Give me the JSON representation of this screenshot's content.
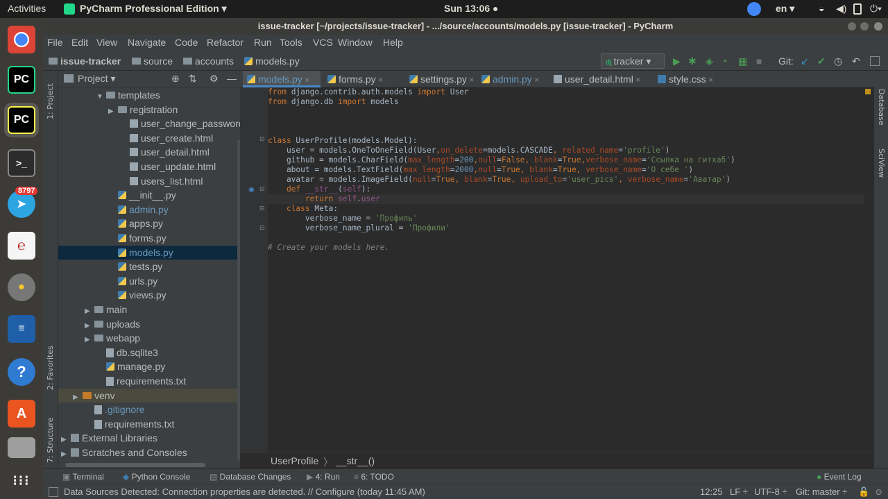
{
  "topbar": {
    "activities": "Activities",
    "app_menu": "PyCharm Professional Edition ▾",
    "clock": "Sun 13:06 ●",
    "lang": "en ▾"
  },
  "launcher": {
    "telegram_badge": "8797"
  },
  "window": {
    "title": "issue-tracker [~/projects/issue-tracker] - .../source/accounts/models.py [issue-tracker] - PyCharm"
  },
  "menu": [
    "File",
    "Edit",
    "View",
    "Navigate",
    "Code",
    "Refactor",
    "Run",
    "Tools",
    "VCS",
    "Window",
    "Help"
  ],
  "nav": {
    "crumbs": [
      "issue-tracker",
      "source",
      "accounts",
      "models.py"
    ],
    "run_config": "tracker ▾",
    "git_label": "Git:"
  },
  "left_strip": {
    "project": "1: Project",
    "favorites": "2: Favorites",
    "structure": "7: Structure"
  },
  "project_panel": {
    "title": "Project ▾",
    "tree": [
      {
        "label": "templates",
        "indent": 3,
        "kind": "folder",
        "arrow": "▼"
      },
      {
        "label": "registration",
        "indent": 4,
        "kind": "folder",
        "arrow": "▶"
      },
      {
        "label": "user_change_password.h",
        "indent": 5,
        "kind": "html"
      },
      {
        "label": "user_create.html",
        "indent": 5,
        "kind": "html"
      },
      {
        "label": "user_detail.html",
        "indent": 5,
        "kind": "html"
      },
      {
        "label": "user_update.html",
        "indent": 5,
        "kind": "html"
      },
      {
        "label": "users_list.html",
        "indent": 5,
        "kind": "html"
      },
      {
        "label": "__init__.py",
        "indent": 4,
        "kind": "py"
      },
      {
        "label": "admin.py",
        "indent": 4,
        "kind": "py",
        "blue": true
      },
      {
        "label": "apps.py",
        "indent": 4,
        "kind": "py"
      },
      {
        "label": "forms.py",
        "indent": 4,
        "kind": "py"
      },
      {
        "label": "models.py",
        "indent": 4,
        "kind": "py",
        "selected": true,
        "blue": true
      },
      {
        "label": "tests.py",
        "indent": 4,
        "kind": "py"
      },
      {
        "label": "urls.py",
        "indent": 4,
        "kind": "py"
      },
      {
        "label": "views.py",
        "indent": 4,
        "kind": "py"
      },
      {
        "label": "main",
        "indent": 2,
        "kind": "folder",
        "arrow": "▶"
      },
      {
        "label": "uploads",
        "indent": 2,
        "kind": "folder",
        "arrow": "▶"
      },
      {
        "label": "webapp",
        "indent": 2,
        "kind": "folder",
        "arrow": "▶"
      },
      {
        "label": "db.sqlite3",
        "indent": 3,
        "kind": "file"
      },
      {
        "label": "manage.py",
        "indent": 3,
        "kind": "py"
      },
      {
        "label": "requirements.txt",
        "indent": 3,
        "kind": "file"
      },
      {
        "label": "venv",
        "indent": 1,
        "kind": "folder-orange",
        "arrow": "▶",
        "tinted": true
      },
      {
        "label": ".gitignore",
        "indent": 2,
        "kind": "file",
        "blue": true
      },
      {
        "label": "requirements.txt",
        "indent": 2,
        "kind": "file"
      },
      {
        "label": "External Libraries",
        "indent": 0,
        "kind": "lib",
        "arrow": "▶"
      },
      {
        "label": "Scratches and Consoles",
        "indent": 0,
        "kind": "lib",
        "arrow": "▶"
      }
    ]
  },
  "tabs": [
    {
      "label": "models.py",
      "active": true,
      "kind": "py"
    },
    {
      "label": "forms.py",
      "kind": "py"
    },
    {
      "label": "settings.py",
      "kind": "py"
    },
    {
      "label": "admin.py",
      "kind": "py",
      "blue": true
    },
    {
      "label": "user_detail.html",
      "kind": "html"
    },
    {
      "label": "style.css",
      "kind": "css"
    }
  ],
  "editor_breadcrumb": [
    "UserProfile",
    "__str__()"
  ],
  "right_strip": {
    "database": "Database",
    "sciview": "SciView"
  },
  "bottom_tools": [
    "Terminal",
    "Python Console",
    "Database Changes",
    "4: Run",
    "6: TODO",
    "Event Log"
  ],
  "status": {
    "message": "Data Sources Detected: Connection properties are detected. // Configure (today 11:45 AM)",
    "position": "12:25",
    "line_sep": "LF ÷",
    "encoding": "UTF-8 ÷",
    "git": "Git: master ÷"
  }
}
